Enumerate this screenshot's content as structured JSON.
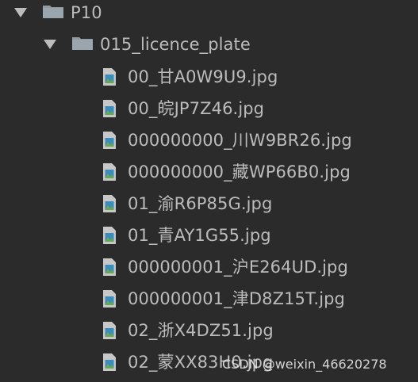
{
  "tree": {
    "root": {
      "label": "P10",
      "icon": "folder-icon",
      "expanded": true
    },
    "subfolder": {
      "label": "015_licence_plate",
      "icon": "folder-icon",
      "expanded": true
    },
    "files": [
      {
        "name": "00_甘A0W9U9.jpg",
        "icon": "image-file-icon"
      },
      {
        "name": "00_皖JP7Z46.jpg",
        "icon": "image-file-icon"
      },
      {
        "name": "000000000_川W9BR26.jpg",
        "icon": "image-file-icon"
      },
      {
        "name": "000000000_藏WP66B0.jpg",
        "icon": "image-file-icon"
      },
      {
        "name": "01_渝R6P85G.jpg",
        "icon": "image-file-icon"
      },
      {
        "name": "01_青AY1G55.jpg",
        "icon": "image-file-icon"
      },
      {
        "name": "000000001_沪E264UD.jpg",
        "icon": "image-file-icon"
      },
      {
        "name": "000000001_津D8Z15T.jpg",
        "icon": "image-file-icon"
      },
      {
        "name": "02_浙X4DZ51.jpg",
        "icon": "image-file-icon"
      },
      {
        "name": "02_蒙XX83H0.jpg",
        "icon": "image-file-icon"
      }
    ]
  },
  "watermark": "CSDN @weixin_46620278",
  "colors": {
    "background": "#2b2b2b",
    "text": "#bcbcbc",
    "folder": "#8f9aa3",
    "arrow": "#bdbdbd"
  }
}
